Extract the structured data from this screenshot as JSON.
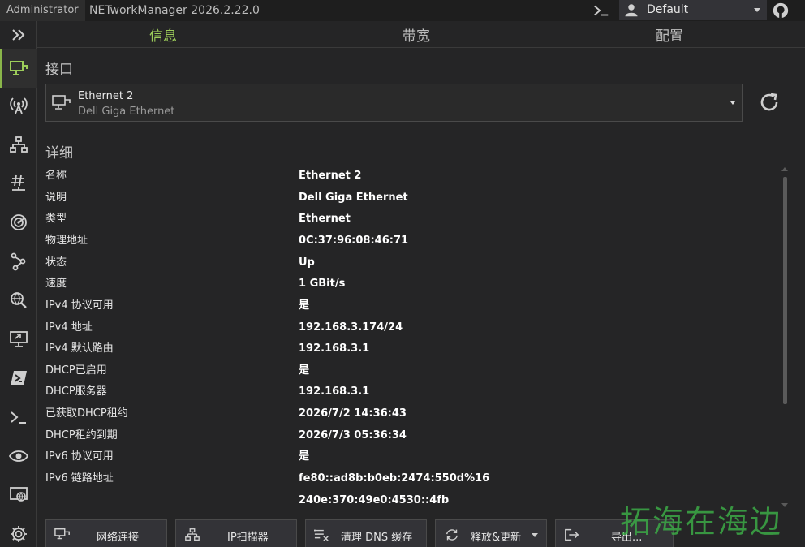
{
  "titlebar": {
    "user_label": "Administrator",
    "app_title": "NETworkManager 2026.2.22.0",
    "profile": "Default"
  },
  "tabs": [
    {
      "label": "信息",
      "active": true
    },
    {
      "label": "带宽",
      "active": false
    },
    {
      "label": "配置",
      "active": false
    }
  ],
  "interface": {
    "section_title": "接口",
    "name": "Ethernet 2",
    "description": "Dell Giga Ethernet"
  },
  "details": {
    "section_title": "详细",
    "rows": [
      {
        "key": "名称",
        "value": "Ethernet 2"
      },
      {
        "key": "说明",
        "value": "Dell Giga Ethernet"
      },
      {
        "key": "类型",
        "value": "Ethernet"
      },
      {
        "key": "物理地址",
        "value": "0C:37:96:08:46:71"
      },
      {
        "key": "状态",
        "value": "Up"
      },
      {
        "key": "速度",
        "value": "1 GBit/s"
      },
      {
        "key": "IPv4 协议可用",
        "value": "是"
      },
      {
        "key": "IPv4 地址",
        "value": "192.168.3.174/24"
      },
      {
        "key": "IPv4 默认路由",
        "value": "192.168.3.1"
      },
      {
        "key": "DHCP已启用",
        "value": "是"
      },
      {
        "key": "DHCP服务器",
        "value": "192.168.3.1"
      },
      {
        "key": "已获取DHCP租约",
        "value": "2026/7/2 14:36:43"
      },
      {
        "key": "DHCP租约到期",
        "value": "2026/7/3 05:36:34"
      },
      {
        "key": "IPv6 协议可用",
        "value": "是"
      },
      {
        "key": "IPv6 链路地址",
        "value": "fe80::ad8b:b0eb:2474:550d%16"
      },
      {
        "key": "",
        "value": "240e:370:49e0:4530::4fb"
      }
    ]
  },
  "actions": {
    "network_connections": "网络连接",
    "ip_scanner": "IP扫描器",
    "flush_dns": "清理 DNS 缓存",
    "release_renew": "释放&更新",
    "export": "导出..."
  },
  "watermark": "拓海在海边",
  "colors": {
    "accent": "#8ab64a",
    "background": "#252526",
    "titlebar": "#1e1e1e"
  }
}
